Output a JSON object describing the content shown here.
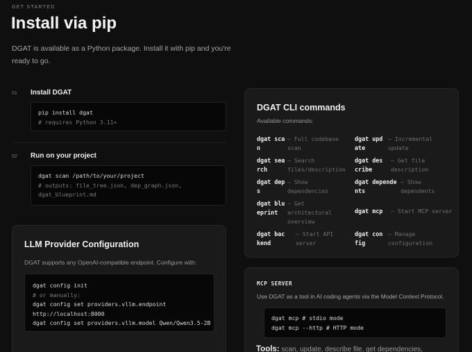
{
  "header": {
    "eyebrow": "GET STARTED",
    "title": "Install via pip",
    "intro": "DGAT is available as a Python package. Install it with pip and you're ready to go."
  },
  "steps": [
    {
      "num": "01",
      "title": "Install DGAT",
      "code_line": "pip install dgat",
      "code_comment": "# requires Python 3.11+"
    },
    {
      "num": "02",
      "title": "Run on your project",
      "code_line": "dgat scan /path/to/your/project",
      "code_comment_1": "# outputs: file_tree.json, dep_graph.json,",
      "code_comment_2": "dgat_blueprint.md"
    }
  ],
  "llm": {
    "title": "LLM Provider Configuration",
    "desc": "DGAT supports any OpenAI-compatible endpoint. Configure with:",
    "l1": "dgat config init",
    "l2": "# or manually:",
    "l3": "dgat config set providers.vllm.endpoint",
    "l4": "http://localhost:8000",
    "l5": "dgat config set providers.vllm.model Qwen/Qwen3.5-2B"
  },
  "cli": {
    "title": "DGAT CLI commands",
    "subtitle": "Available commands:",
    "commands": [
      {
        "name": "dgat scan",
        "desc": "— Full codebase scan"
      },
      {
        "name": "dgat update",
        "desc": "— Incremental update"
      },
      {
        "name": "dgat search",
        "desc": "— Search files/description"
      },
      {
        "name": "dgat describe",
        "desc": "— Get file description"
      },
      {
        "name": "dgat deps",
        "desc": "— Show dependencies"
      },
      {
        "name": "dgat dependents",
        "desc": "— Show dependents"
      },
      {
        "name": "dgat blueprint",
        "desc": "— Get architectural overview"
      },
      {
        "name": "dgat mcp",
        "desc": "— Start MCP server"
      },
      {
        "name": "dgat backend",
        "desc": "— Start API server"
      },
      {
        "name": "dgat config",
        "desc": "— Manage configuration"
      }
    ]
  },
  "mcp": {
    "label": "MCP SERVER",
    "desc": "Use DGAT as a tool in AI coding agents via the Model Context Protocol.",
    "l1": "dgat mcp # stdio mode",
    "l2": "dgat mcp --http # HTTP mode",
    "tools_label": "Tools:",
    "tools_text": "scan, update, describe file, get dependencies,"
  }
}
